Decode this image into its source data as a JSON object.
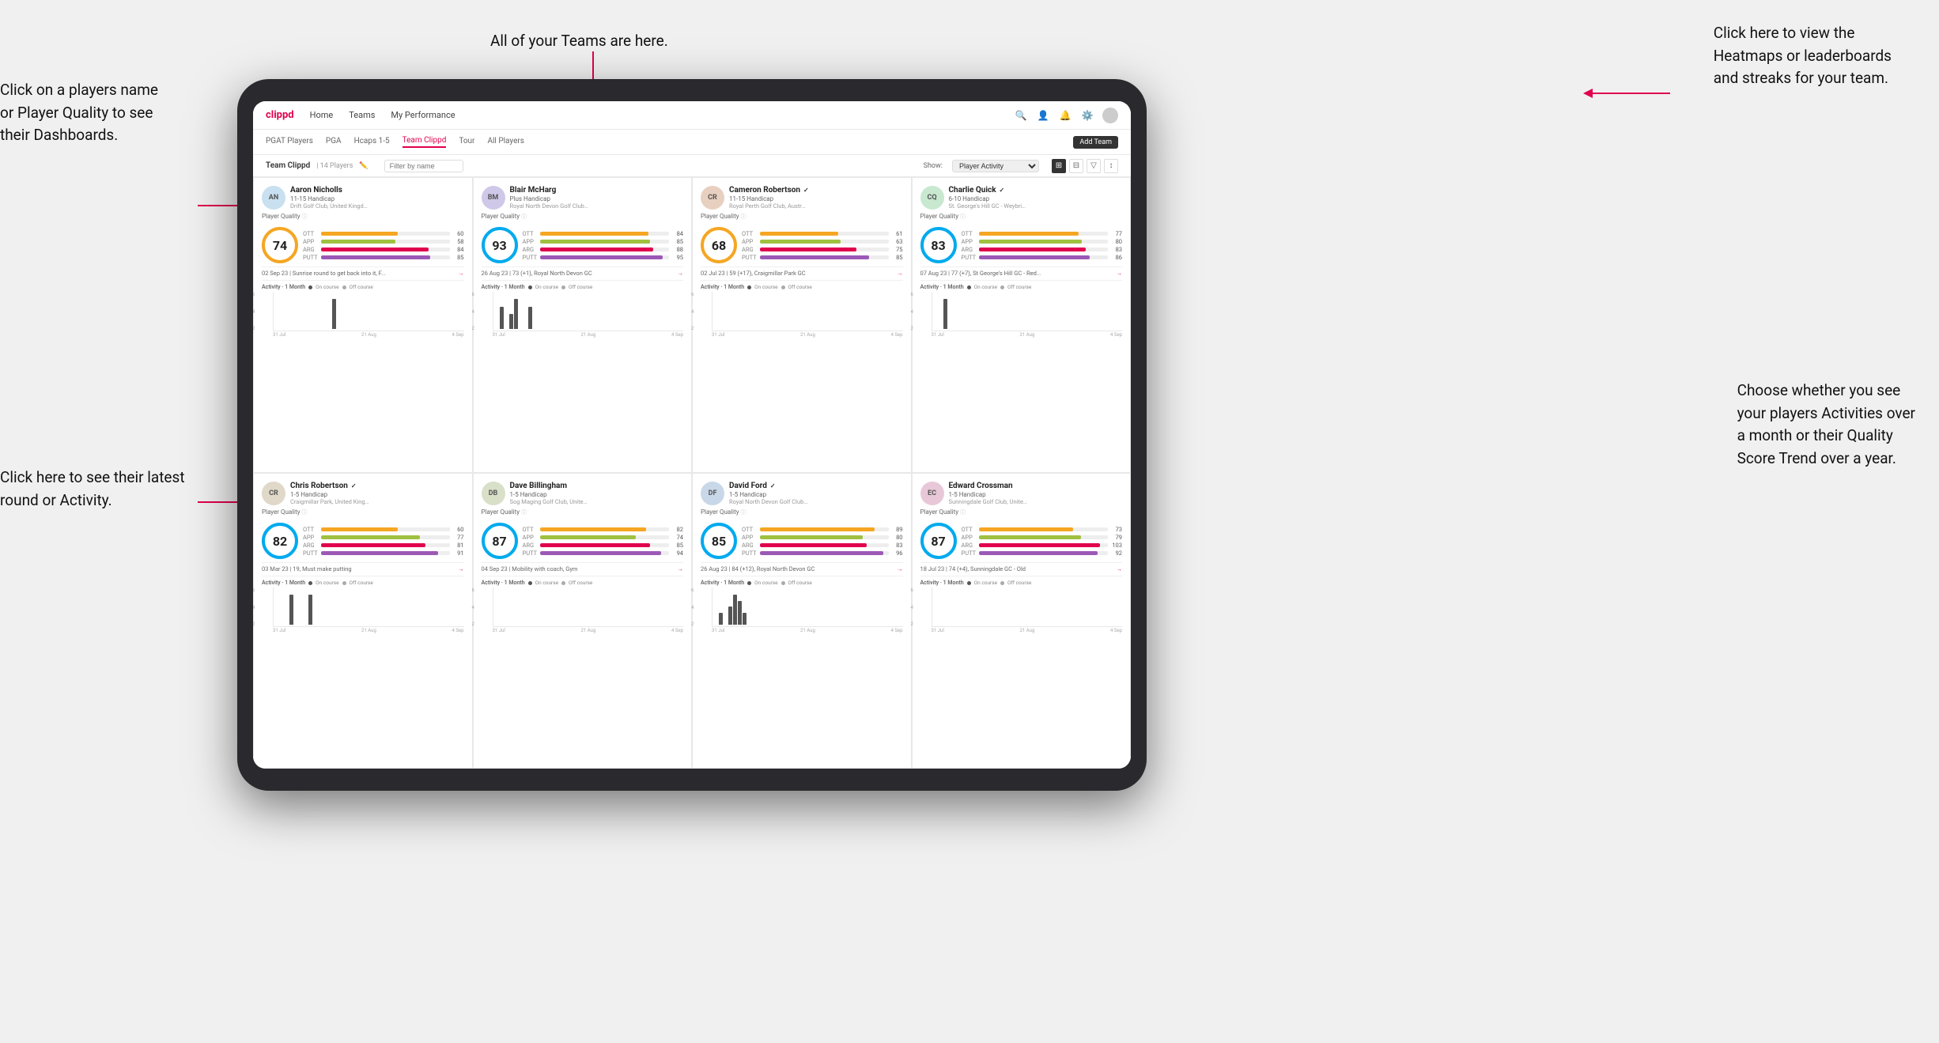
{
  "annotations": {
    "top_center": "All of your Teams are here.",
    "top_right": "Click here to view the\nHeatmaps or leaderboards\nand streaks for your team.",
    "left_top": "Click on a players name\nor Player Quality to see\ntheir Dashboards.",
    "left_bottom": "Click here to see their latest\nround or Activity.",
    "right_bottom": "Choose whether you see\nyour players Activities over\na month or their Quality\nScore Trend over a year."
  },
  "navbar": {
    "logo": "clippd",
    "items": [
      "Home",
      "Teams",
      "My Performance"
    ],
    "icons": [
      "search",
      "user",
      "bell",
      "settings",
      "avatar"
    ]
  },
  "subtabs": {
    "items": [
      "PGAT Players",
      "PGA",
      "Hcaps 1-5",
      "Team Clippd",
      "Tour",
      "All Players"
    ],
    "active": "Team Clippd",
    "add_button": "Add Team"
  },
  "team_header": {
    "title": "Team Clippd",
    "count": "| 14 Players",
    "filter_placeholder": "Filter by name",
    "show_label": "Show:",
    "show_value": "Player Activity",
    "view_icons": [
      "grid2",
      "grid3",
      "filter",
      "sort"
    ]
  },
  "players": [
    {
      "name": "Aaron Nicholls",
      "handicap": "11-15 Handicap",
      "club": "Drift Golf Club, United Kingdom",
      "verified": false,
      "quality": 74,
      "quality_class": "",
      "stats": [
        {
          "label": "OTT",
          "value": 60,
          "max": 100,
          "type": "ott"
        },
        {
          "label": "APP",
          "value": 58,
          "max": 100,
          "type": "app"
        },
        {
          "label": "ARG",
          "value": 84,
          "max": 100,
          "type": "arg"
        },
        {
          "label": "PUTT",
          "value": 85,
          "max": 100,
          "type": "putt"
        }
      ],
      "latest_round": "02 Sep 23 | Sunrise round to get back into it, F...",
      "activity_label": "Activity · 1 Month",
      "chart_bars": [
        0,
        0,
        0,
        0,
        0,
        0,
        0,
        0,
        0,
        0,
        0,
        0,
        2,
        0
      ],
      "dates": [
        "31 Jul",
        "21 Aug",
        "4 Sep"
      ]
    },
    {
      "name": "Blair McHarg",
      "handicap": "Plus Handicap",
      "club": "Royal North Devon Golf Club, United Kin...",
      "verified": false,
      "quality": 93,
      "quality_class": "q93",
      "stats": [
        {
          "label": "OTT",
          "value": 84,
          "max": 100,
          "type": "ott"
        },
        {
          "label": "APP",
          "value": 85,
          "max": 100,
          "type": "app"
        },
        {
          "label": "ARG",
          "value": 88,
          "max": 100,
          "type": "arg"
        },
        {
          "label": "PUTT",
          "value": 95,
          "max": 100,
          "type": "putt"
        }
      ],
      "latest_round": "26 Aug 23 | 73 (+1), Royal North Devon GC",
      "activity_label": "Activity · 1 Month",
      "chart_bars": [
        0,
        3,
        0,
        2,
        4,
        0,
        0,
        3,
        0
      ],
      "dates": [
        "31 Jul",
        "21 Aug",
        "4 Sep"
      ]
    },
    {
      "name": "Cameron Robertson",
      "handicap": "11-15 Handicap",
      "club": "Royal Perth Golf Club, Australia",
      "verified": true,
      "quality": 68,
      "quality_class": "q68",
      "stats": [
        {
          "label": "OTT",
          "value": 61,
          "max": 100,
          "type": "ott"
        },
        {
          "label": "APP",
          "value": 63,
          "max": 100,
          "type": "app"
        },
        {
          "label": "ARG",
          "value": 75,
          "max": 100,
          "type": "arg"
        },
        {
          "label": "PUTT",
          "value": 85,
          "max": 100,
          "type": "putt"
        }
      ],
      "latest_round": "02 Jul 23 | 59 (+17), Craigmillar Park GC",
      "activity_label": "Activity · 1 Month",
      "chart_bars": [
        0,
        0,
        0,
        0,
        0,
        0,
        0,
        0,
        0
      ],
      "dates": [
        "31 Jul",
        "21 Aug",
        "4 Sep"
      ]
    },
    {
      "name": "Charlie Quick",
      "handicap": "6-10 Handicap",
      "club": "St. George's Hill GC - Weybridge - Surre...",
      "verified": true,
      "quality": 83,
      "quality_class": "q83",
      "stats": [
        {
          "label": "OTT",
          "value": 77,
          "max": 100,
          "type": "ott"
        },
        {
          "label": "APP",
          "value": 80,
          "max": 100,
          "type": "app"
        },
        {
          "label": "ARG",
          "value": 83,
          "max": 100,
          "type": "arg"
        },
        {
          "label": "PUTT",
          "value": 86,
          "max": 100,
          "type": "putt"
        }
      ],
      "latest_round": "07 Aug 23 | 77 (+7), St George's Hill GC - Red...",
      "activity_label": "Activity · 1 Month",
      "chart_bars": [
        0,
        0,
        1,
        0,
        0,
        0,
        0,
        0,
        0
      ],
      "dates": [
        "31 Jul",
        "21 Aug",
        "4 Sep"
      ]
    },
    {
      "name": "Chris Robertson",
      "handicap": "1-5 Handicap",
      "club": "Craigmillar Park, United Kingdom",
      "verified": true,
      "quality": 82,
      "quality_class": "q82",
      "stats": [
        {
          "label": "OTT",
          "value": 60,
          "max": 100,
          "type": "ott"
        },
        {
          "label": "APP",
          "value": 77,
          "max": 100,
          "type": "app"
        },
        {
          "label": "ARG",
          "value": 81,
          "max": 100,
          "type": "arg"
        },
        {
          "label": "PUTT",
          "value": 91,
          "max": 100,
          "type": "putt"
        }
      ],
      "latest_round": "03 Mar 23 | 19, Must make putting",
      "activity_label": "Activity · 1 Month",
      "chart_bars": [
        0,
        0,
        0,
        1,
        0,
        0,
        0,
        1,
        0
      ],
      "dates": [
        "31 Jul",
        "21 Aug",
        "4 Sep"
      ]
    },
    {
      "name": "Dave Billingham",
      "handicap": "1-5 Handicap",
      "club": "Sog Maging Golf Club, United Kingdom",
      "verified": false,
      "quality": 87,
      "quality_class": "q87",
      "stats": [
        {
          "label": "OTT",
          "value": 82,
          "max": 100,
          "type": "ott"
        },
        {
          "label": "APP",
          "value": 74,
          "max": 100,
          "type": "app"
        },
        {
          "label": "ARG",
          "value": 85,
          "max": 100,
          "type": "arg"
        },
        {
          "label": "PUTT",
          "value": 94,
          "max": 100,
          "type": "putt"
        }
      ],
      "latest_round": "04 Sep 23 | Mobility with coach, Gym",
      "activity_label": "Activity · 1 Month",
      "chart_bars": [
        0,
        0,
        0,
        0,
        0,
        0,
        0,
        0,
        0
      ],
      "dates": [
        "31 Jul",
        "21 Aug",
        "4 Sep"
      ]
    },
    {
      "name": "David Ford",
      "handicap": "1-5 Handicap",
      "club": "Royal North Devon Golf Club, United Kil...",
      "verified": true,
      "quality": 85,
      "quality_class": "q85",
      "stats": [
        {
          "label": "OTT",
          "value": 89,
          "max": 100,
          "type": "ott"
        },
        {
          "label": "APP",
          "value": 80,
          "max": 100,
          "type": "app"
        },
        {
          "label": "ARG",
          "value": 83,
          "max": 100,
          "type": "arg"
        },
        {
          "label": "PUTT",
          "value": 96,
          "max": 100,
          "type": "putt"
        }
      ],
      "latest_round": "26 Aug 23 | 84 (+12), Royal North Devon GC",
      "activity_label": "Activity · 1 Month",
      "chart_bars": [
        0,
        2,
        0,
        3,
        5,
        4,
        2,
        0,
        0
      ],
      "dates": [
        "31 Jul",
        "21 Aug",
        "4 Sep"
      ]
    },
    {
      "name": "Edward Crossman",
      "handicap": "1-5 Handicap",
      "club": "Sunningdale Golf Club, United Kingdom",
      "verified": false,
      "quality": 87,
      "quality_class": "q87b",
      "stats": [
        {
          "label": "OTT",
          "value": 73,
          "max": 100,
          "type": "ott"
        },
        {
          "label": "APP",
          "value": 79,
          "max": 100,
          "type": "app"
        },
        {
          "label": "ARG",
          "value": 103,
          "max": 110,
          "type": "arg"
        },
        {
          "label": "PUTT",
          "value": 92,
          "max": 100,
          "type": "putt"
        }
      ],
      "latest_round": "18 Jul 23 | 74 (+4), Sunningdale GC - Old",
      "activity_label": "Activity · 1 Month",
      "chart_bars": [
        0,
        0,
        0,
        0,
        0,
        0,
        0,
        0,
        0
      ],
      "dates": [
        "31 Jul",
        "21 Aug",
        "4 Sep"
      ]
    }
  ]
}
